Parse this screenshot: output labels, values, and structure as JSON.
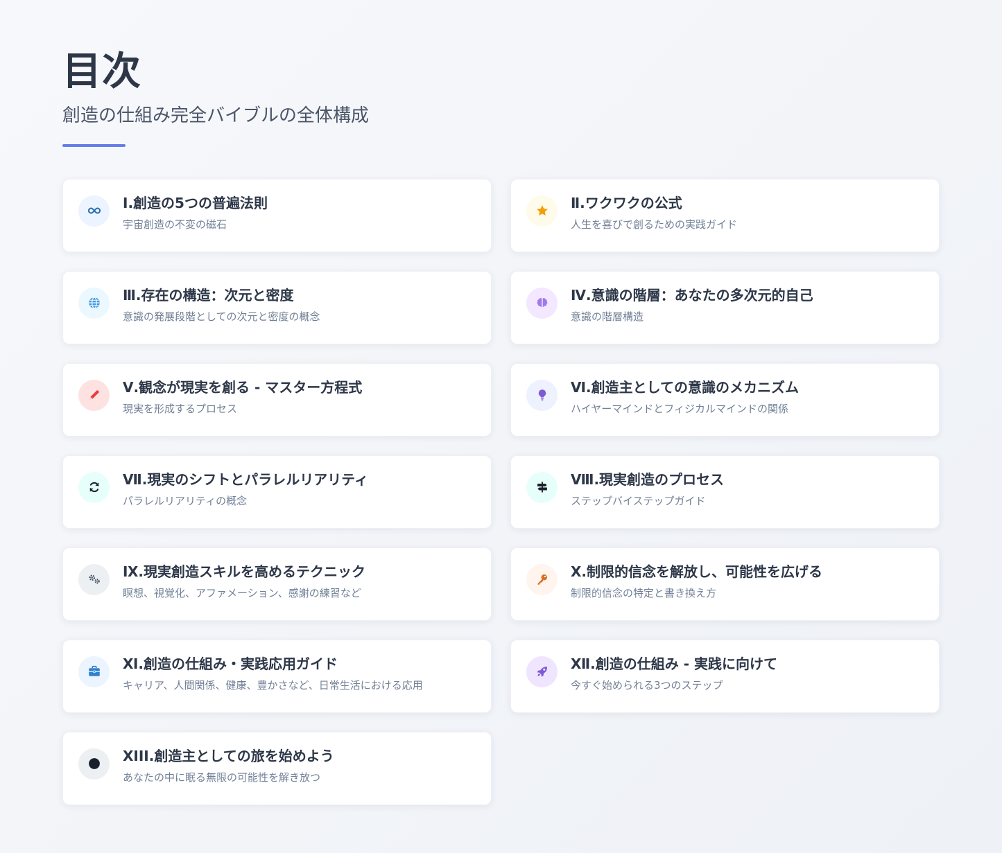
{
  "header": {
    "title": "目次",
    "subtitle": "創造の仕組み完全バイブルの全体構成"
  },
  "colors": {
    "accent": "#667eea",
    "title_text": "#2d3748",
    "desc_text": "#718096"
  },
  "items": [
    {
      "title": "Ⅰ.創造の5つの普遍法則",
      "desc": "宇宙創造の不変の磁石",
      "icon": "infinity-icon"
    },
    {
      "title": "Ⅱ.ワクワクの公式",
      "desc": "人生を喜びで創るための実践ガイド",
      "icon": "star-icon"
    },
    {
      "title": "Ⅲ.存在の構造：次元と密度",
      "desc": "意識の発展段階としての次元と密度の概念",
      "icon": "globe-icon"
    },
    {
      "title": "Ⅳ.意識の階層：あなたの多次元的自己",
      "desc": "意識の階層構造",
      "icon": "brain-icon"
    },
    {
      "title": "Ⅴ.観念が現実を創る - マスター方程式",
      "desc": "現実を形成するプロセス",
      "icon": "pencil-icon"
    },
    {
      "title": "Ⅵ.創造主としての意識のメカニズム",
      "desc": "ハイヤーマインドとフィジカルマインドの関係",
      "icon": "lightbulb-icon"
    },
    {
      "title": "Ⅶ.現実のシフトとパラレルリアリティ",
      "desc": "パラレルリアリティの概念",
      "icon": "sync-icon"
    },
    {
      "title": "Ⅷ.現実創造のプロセス",
      "desc": "ステップバイステップガイド",
      "icon": "signpost-icon"
    },
    {
      "title": "Ⅸ.現実創造スキルを高めるテクニック",
      "desc": "瞑想、視覚化、アファメーション、感謝の練習など",
      "icon": "gears-icon"
    },
    {
      "title": "Ⅹ.制限的信念を解放し、可能性を広げる",
      "desc": "制限的信念の特定と書き換え方",
      "icon": "key-icon"
    },
    {
      "title": "Ⅺ.創造の仕組み・実践応用ガイド",
      "desc": "キャリア、人間関係、健康、豊かさなど、日常生活における応用",
      "icon": "briefcase-icon"
    },
    {
      "title": "Ⅻ.創造の仕組み - 実践に向けて",
      "desc": "今すぐ始められる3つのステップ",
      "icon": "rocket-icon"
    },
    {
      "title": "XIII.創造主としての旅を始めよう",
      "desc": "あなたの中に眠る無限の可能性を解き放つ",
      "icon": "circle-icon"
    }
  ]
}
